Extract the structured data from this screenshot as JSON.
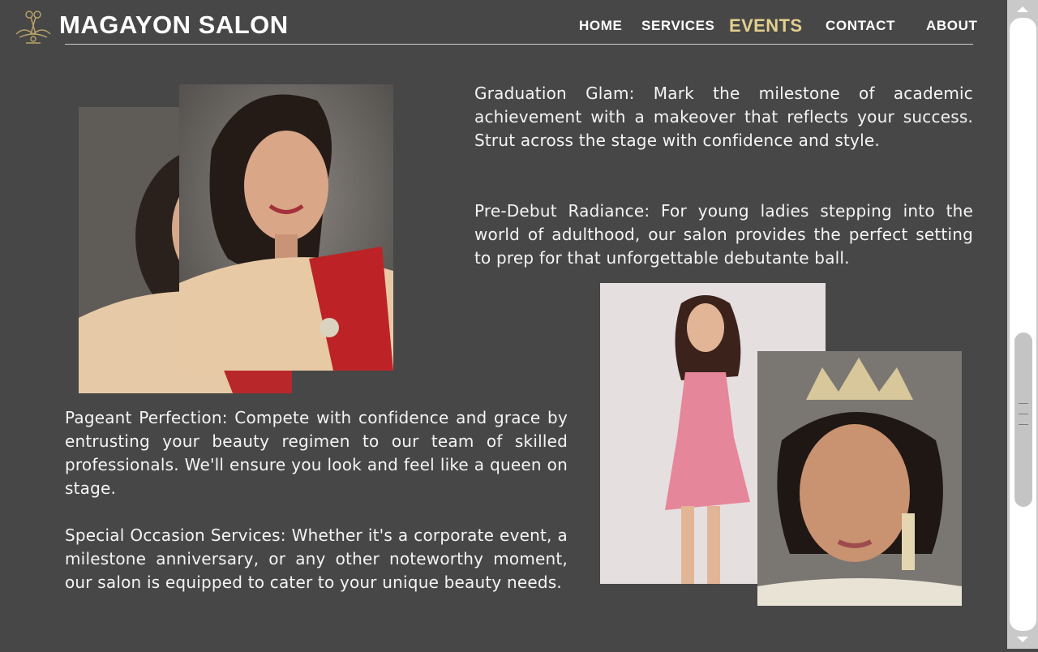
{
  "brand": {
    "name": "MAGAYON SALON"
  },
  "nav": {
    "items": [
      {
        "label": "HOME"
      },
      {
        "label": "SERVICES"
      },
      {
        "label": "EVENTS"
      },
      {
        "label": "CONTACT"
      },
      {
        "label": "ABOUT"
      }
    ],
    "active": "EVENTS"
  },
  "content": {
    "graduation": "Graduation Glam: Mark the milestone of academic achievement with a makeover that reflects your success. Strut across the stage with confidence and style.",
    "predebut": "Pre-Debut Radiance: For young ladies stepping into the world of adulthood, our salon provides the perfect setting to prep for that unforgettable debutante ball.",
    "pageant": "Pageant Perfection: Compete with confidence and grace by entrusting your beauty regimen to our team of skilled professionals. We'll ensure you look and feel like a queen on stage.",
    "special": "Special Occasion Services: Whether it's a corporate event, a milestone anniversary, or any other noteworthy moment, our salon is equipped to cater to your unique beauty needs."
  },
  "colors": {
    "background": "#474747",
    "accent": "#e3cf8d",
    "text": "#ffffff"
  },
  "icons": {
    "logo": "scissors-logo-icon"
  }
}
